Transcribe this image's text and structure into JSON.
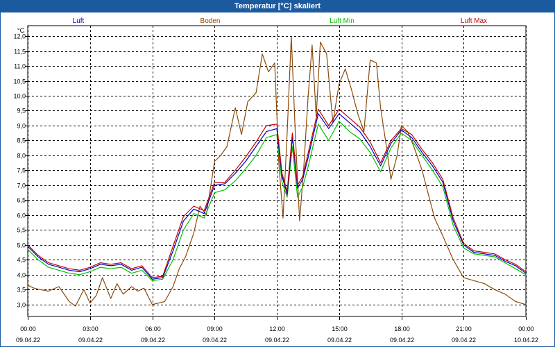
{
  "window": {
    "title": "Temperatur [°C] skaliert"
  },
  "colors": {
    "titlebar": "#1c5aa0",
    "luft": "#0000c8",
    "boden": "#8a4a08",
    "luft_min": "#00c000",
    "luft_max": "#c00000"
  },
  "chart_data": {
    "type": "line",
    "title": "Temperatur [°C] skaliert",
    "ylabel": "°C",
    "ylim": [
      2.6,
      12.35
    ],
    "yticks": [
      "12,0",
      "11,5",
      "11,0",
      "10,5",
      "10,0",
      "9,5",
      "9,0",
      "8,5",
      "8,0",
      "7,5",
      "7,0",
      "6,5",
      "6,0",
      "5,5",
      "5,0",
      "4,5",
      "4,0",
      "3,5",
      "3,0"
    ],
    "ytick_values": [
      12.0,
      11.5,
      11.0,
      10.5,
      10.0,
      9.5,
      9.0,
      8.5,
      8.0,
      7.5,
      7.0,
      6.5,
      6.0,
      5.5,
      5.0,
      4.5,
      4.0,
      3.5,
      3.0
    ],
    "xlim": [
      0,
      24
    ],
    "xticks": [
      {
        "time": "00:00",
        "date": "09.04.22",
        "hour": 0
      },
      {
        "time": "03:00",
        "date": "09.04.22",
        "hour": 3
      },
      {
        "time": "06:00",
        "date": "09.04.22",
        "hour": 6
      },
      {
        "time": "09:00",
        "date": "09.04.22",
        "hour": 9
      },
      {
        "time": "12:00",
        "date": "09.04.22",
        "hour": 12
      },
      {
        "time": "15:00",
        "date": "09.04.22",
        "hour": 15
      },
      {
        "time": "18:00",
        "date": "09.04.22",
        "hour": 18
      },
      {
        "time": "21:00",
        "date": "09.04.22",
        "hour": 21
      },
      {
        "time": "00:00",
        "date": "10.04.22",
        "hour": 24
      }
    ],
    "grid": true,
    "legend_position": "top",
    "series": [
      {
        "name": "Luft",
        "color": "#0000c8",
        "x": [
          0,
          0.5,
          1,
          1.5,
          2,
          2.5,
          3,
          3.5,
          4,
          4.5,
          5,
          5.5,
          6,
          6.5,
          7,
          7.5,
          8,
          8.5,
          9,
          9.5,
          10,
          10.5,
          11,
          11.5,
          12,
          12.25,
          12.5,
          12.75,
          13,
          13.25,
          13.5,
          14,
          14.5,
          15,
          15.5,
          16,
          16.5,
          17,
          17.5,
          18,
          18.5,
          19,
          19.5,
          20,
          20.5,
          21,
          21.5,
          22,
          22.5,
          23,
          23.5,
          24
        ],
        "y": [
          4.95,
          4.6,
          4.35,
          4.25,
          4.15,
          4.1,
          4.2,
          4.35,
          4.3,
          4.35,
          4.15,
          4.25,
          3.85,
          3.9,
          4.8,
          5.8,
          6.2,
          6.05,
          7.0,
          7.05,
          7.4,
          7.8,
          8.3,
          8.8,
          8.9,
          7.3,
          6.7,
          8.6,
          6.9,
          7.2,
          7.9,
          9.4,
          8.9,
          9.4,
          9.1,
          8.8,
          8.3,
          7.65,
          8.4,
          8.85,
          8.6,
          8.1,
          7.65,
          7.1,
          5.8,
          5.0,
          4.75,
          4.7,
          4.65,
          4.45,
          4.3,
          4.05
        ]
      },
      {
        "name": "Boden",
        "color": "#8a4a08",
        "x": [
          0,
          0.3,
          0.6,
          1,
          1.5,
          2,
          2.3,
          2.7,
          3,
          3.3,
          3.6,
          4,
          4.3,
          4.6,
          5,
          5.3,
          5.6,
          6,
          6.3,
          6.6,
          7,
          7.3,
          7.6,
          8,
          8.3,
          8.6,
          9,
          9.3,
          9.6,
          10,
          10.3,
          10.6,
          11,
          11.3,
          11.6,
          11.9,
          12.1,
          12.3,
          12.5,
          12.7,
          12.9,
          13.1,
          13.3,
          13.5,
          13.7,
          13.9,
          14.1,
          14.4,
          14.7,
          15,
          15.3,
          15.6,
          15.9,
          16.2,
          16.5,
          16.8,
          17,
          17.3,
          17.5,
          17.8,
          18,
          18.3,
          18.6,
          19,
          19.3,
          19.6,
          20,
          20.5,
          21,
          21.5,
          22,
          22.5,
          23,
          23.5,
          24
        ],
        "y": [
          3.65,
          3.55,
          3.5,
          3.45,
          3.6,
          3.1,
          2.95,
          3.5,
          3.05,
          3.3,
          3.9,
          3.2,
          3.7,
          3.35,
          3.6,
          3.45,
          3.55,
          3.0,
          3.05,
          3.1,
          3.6,
          4.2,
          4.6,
          5.4,
          6.3,
          6.0,
          7.8,
          8.0,
          8.3,
          9.6,
          8.7,
          9.8,
          10.1,
          11.4,
          10.8,
          11.1,
          7.7,
          5.9,
          8.8,
          12.0,
          8.6,
          5.8,
          7.6,
          9.9,
          11.7,
          9.3,
          11.8,
          11.4,
          9.1,
          10.4,
          10.9,
          10.2,
          9.4,
          8.8,
          11.2,
          11.1,
          9.6,
          8.2,
          7.2,
          8.0,
          9.0,
          8.8,
          8.3,
          7.5,
          6.7,
          5.9,
          5.3,
          4.5,
          3.9,
          3.8,
          3.7,
          3.5,
          3.35,
          3.1,
          3.0
        ]
      },
      {
        "name": "Luft Min",
        "color": "#00c000",
        "x": [
          0,
          0.5,
          1,
          1.5,
          2,
          2.5,
          3,
          3.5,
          4,
          4.5,
          5,
          5.5,
          6,
          6.5,
          7,
          7.5,
          8,
          8.5,
          9,
          9.5,
          10,
          10.5,
          11,
          11.5,
          12,
          12.25,
          12.5,
          12.75,
          13,
          13.25,
          13.5,
          14,
          14.5,
          15,
          15.5,
          16,
          16.5,
          17,
          17.5,
          18,
          18.5,
          19,
          19.5,
          20,
          20.5,
          21,
          21.5,
          22,
          22.5,
          23,
          23.5,
          24
        ],
        "y": [
          4.85,
          4.5,
          4.25,
          4.15,
          4.05,
          4.0,
          4.1,
          4.25,
          4.2,
          4.25,
          4.05,
          4.15,
          3.8,
          3.85,
          4.5,
          5.5,
          6.05,
          5.9,
          6.75,
          6.85,
          7.15,
          7.55,
          8.0,
          8.6,
          8.7,
          7.1,
          6.6,
          8.3,
          6.6,
          6.95,
          7.6,
          9.05,
          8.5,
          9.15,
          8.8,
          8.55,
          8.1,
          7.45,
          8.25,
          8.75,
          8.5,
          8.0,
          7.5,
          6.95,
          5.65,
          4.9,
          4.7,
          4.65,
          4.6,
          4.4,
          4.2,
          4.0
        ]
      },
      {
        "name": "Luft Max",
        "color": "#c00000",
        "x": [
          0,
          0.5,
          1,
          1.5,
          2,
          2.5,
          3,
          3.5,
          4,
          4.5,
          5,
          5.5,
          6,
          6.5,
          7,
          7.5,
          8,
          8.5,
          9,
          9.5,
          10,
          10.5,
          11,
          11.5,
          12,
          12.25,
          12.5,
          12.75,
          13,
          13.25,
          13.5,
          14,
          14.5,
          15,
          15.5,
          16,
          16.5,
          17,
          17.5,
          18,
          18.5,
          19,
          19.5,
          20,
          20.5,
          21,
          21.5,
          22,
          22.5,
          23,
          23.5,
          24
        ],
        "y": [
          5.0,
          4.65,
          4.4,
          4.3,
          4.2,
          4.15,
          4.25,
          4.4,
          4.35,
          4.4,
          4.2,
          4.3,
          3.9,
          3.95,
          4.95,
          5.95,
          6.3,
          6.15,
          7.1,
          7.1,
          7.5,
          7.95,
          8.45,
          9.0,
          9.05,
          7.4,
          6.8,
          8.75,
          7.0,
          7.3,
          8.05,
          9.55,
          9.0,
          9.55,
          9.25,
          8.95,
          8.45,
          7.75,
          8.5,
          8.9,
          8.7,
          8.2,
          7.75,
          7.2,
          5.9,
          5.05,
          4.8,
          4.75,
          4.7,
          4.5,
          4.35,
          4.1
        ]
      }
    ]
  }
}
